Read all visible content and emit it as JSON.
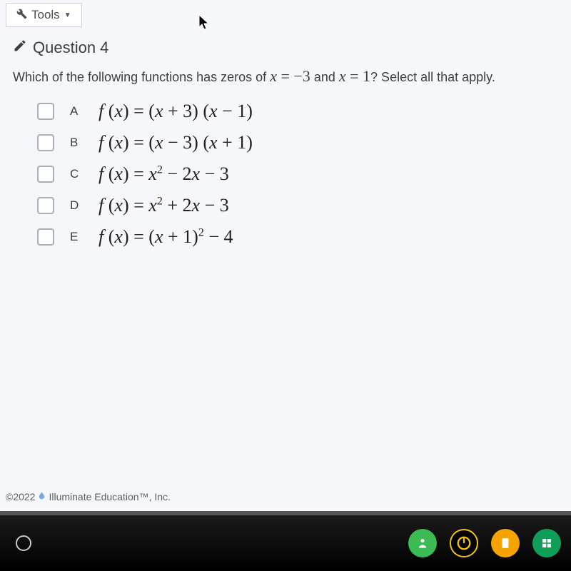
{
  "toolbar": {
    "label": "Tools"
  },
  "question": {
    "number": "Question 4",
    "prompt_pre": "Which of the following functions has zeros of ",
    "zero1_var": "x",
    "zero1_eq": " = ",
    "zero1_val": "−3",
    "mid": " and ",
    "zero2_var": "x",
    "zero2_eq": " = ",
    "zero2_val": "1",
    "prompt_post": "? Select all that apply."
  },
  "options": {
    "A": {
      "letter": "A",
      "formula_html": "f (x) = (x + 3) (x − 1)"
    },
    "B": {
      "letter": "B",
      "formula_html": "f (x) = (x − 3) (x + 1)"
    },
    "C": {
      "letter": "C",
      "formula_html": "f (x) = x² − 2x − 3"
    },
    "D": {
      "letter": "D",
      "formula_html": "f (x) = x² + 2x − 3"
    },
    "E": {
      "letter": "E",
      "formula_html": "f (x) = (x + 1)² − 4"
    }
  },
  "footer": {
    "copyright": "©2022",
    "company": "Illuminate Education™, Inc."
  }
}
